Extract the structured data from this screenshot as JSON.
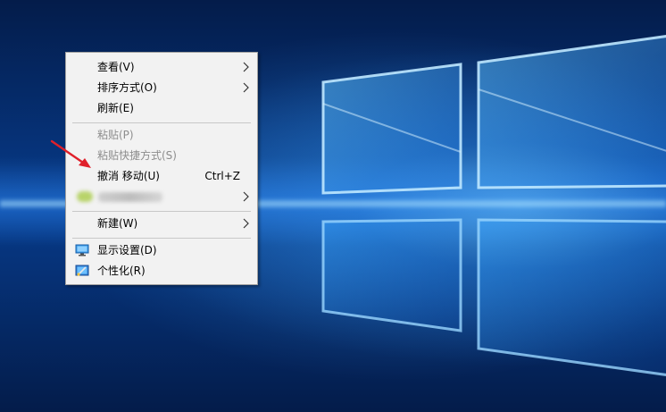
{
  "colors": {
    "menu_background": "#f2f2f2",
    "menu_border": "#a0a0a0",
    "disabled_text": "#8d8d8d",
    "annotation_arrow": "#e0202a"
  },
  "context_menu": {
    "items": [
      {
        "label": "查看(V)",
        "enabled": true,
        "has_submenu": true
      },
      {
        "label": "排序方式(O)",
        "enabled": true,
        "has_submenu": true
      },
      {
        "label": "刷新(E)",
        "enabled": true,
        "has_submenu": false
      },
      {
        "label": "粘贴(P)",
        "enabled": false,
        "has_submenu": false
      },
      {
        "label": "粘贴快捷方式(S)",
        "enabled": false,
        "has_submenu": false
      },
      {
        "label": "撤消 移动(U)",
        "shortcut": "Ctrl+Z",
        "enabled": true,
        "has_submenu": false
      },
      {
        "label": "",
        "enabled": true,
        "has_submenu": true,
        "blurred": true
      },
      {
        "label": "新建(W)",
        "enabled": true,
        "has_submenu": true
      },
      {
        "label": "显示设置(D)",
        "enabled": true,
        "has_submenu": false,
        "icon": "display-settings-icon"
      },
      {
        "label": "个性化(R)",
        "enabled": true,
        "has_submenu": false,
        "icon": "personalize-icon"
      }
    ]
  }
}
